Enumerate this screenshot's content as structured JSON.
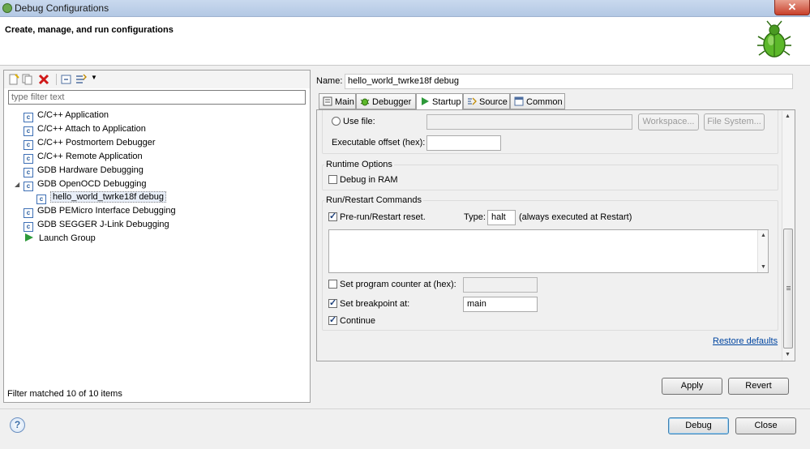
{
  "window": {
    "title": "Debug Configurations"
  },
  "header": {
    "title": "Create, manage, and run configurations"
  },
  "left": {
    "filter_placeholder": "type filter text",
    "tree": [
      {
        "label": "C/C++ Application",
        "icon": "c-config-icon"
      },
      {
        "label": "C/C++ Attach to Application",
        "icon": "c-config-icon"
      },
      {
        "label": "C/C++ Postmortem Debugger",
        "icon": "c-config-icon"
      },
      {
        "label": "C/C++ Remote Application",
        "icon": "c-config-icon"
      },
      {
        "label": "GDB Hardware Debugging",
        "icon": "c-config-icon"
      },
      {
        "label": "GDB OpenOCD Debugging",
        "icon": "c-config-icon"
      },
      {
        "label": "hello_world_twrke18f debug",
        "icon": "c-config-icon"
      },
      {
        "label": "GDB PEMicro Interface Debugging",
        "icon": "c-config-icon"
      },
      {
        "label": "GDB SEGGER J-Link Debugging",
        "icon": "c-config-icon"
      },
      {
        "label": "Launch Group",
        "icon": "launch-group-icon"
      }
    ],
    "footer": "Filter matched 10 of 10 items"
  },
  "right": {
    "name_label": "Name:",
    "name_value": "hello_world_twrke18f debug",
    "tabs": [
      {
        "label": "Main",
        "icon": "main-tab-icon"
      },
      {
        "label": "Debugger",
        "icon": "debugger-tab-icon"
      },
      {
        "label": "Startup",
        "icon": "startup-tab-icon",
        "active": true
      },
      {
        "label": "Source",
        "icon": "source-tab-icon"
      },
      {
        "label": "Common",
        "icon": "common-tab-icon"
      }
    ],
    "startup": {
      "use_file_label": "Use file:",
      "workspace_btn": "Workspace...",
      "filesystem_btn": "File System...",
      "exec_offset_label": "Executable offset (hex):",
      "runtime_options_label": "Runtime Options",
      "debug_in_ram_label": "Debug in RAM",
      "run_restart_label": "Run/Restart Commands",
      "prerun_reset_label": "Pre-run/Restart reset.",
      "type_label": "Type:",
      "type_value": "halt",
      "always_note": "(always executed at Restart)",
      "set_pc_label": "Set program counter at (hex):",
      "set_bp_label": "Set breakpoint at:",
      "bp_value": "main",
      "continue_label": "Continue",
      "restore_defaults": "Restore defaults"
    },
    "apply_btn": "Apply",
    "revert_btn": "Revert"
  },
  "footer": {
    "debug_btn": "Debug",
    "close_btn": "Close"
  }
}
